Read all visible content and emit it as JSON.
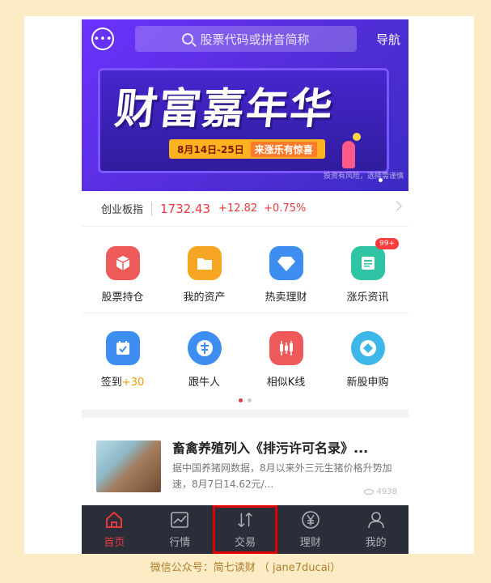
{
  "header": {
    "search_placeholder": "股票代码或拼音简称",
    "nav_label": "导航"
  },
  "banner": {
    "title": "财富嘉年华",
    "date": "8月14日-25日",
    "slogan": "来涨乐有惊喜",
    "disclaimer": "投资有风险，选择需谨慎"
  },
  "index": {
    "name": "创业板指",
    "value": "1732.43",
    "change": "+12.82",
    "pct": "+0.75%",
    "color": "#e8383d"
  },
  "grid": {
    "row1": [
      {
        "label": "股票持仓",
        "color": "#ee5a5a"
      },
      {
        "label": "我的资产",
        "color": "#f6a623"
      },
      {
        "label": "热卖理财",
        "color": "#3d8ef0"
      },
      {
        "label": "涨乐资讯",
        "color": "#2fc4a4",
        "badge": "99+"
      }
    ],
    "row2": [
      {
        "label": "签到",
        "label_highlight": "+30",
        "color": "#3d8ef0"
      },
      {
        "label": "跟牛人",
        "color": "#3d8ef0"
      },
      {
        "label": "相似K线",
        "color": "#ee5a5a"
      },
      {
        "label": "新股申购",
        "color": "#3db6e8"
      }
    ]
  },
  "news": {
    "headline": "畜禽养殖列入《排污许可名录》...",
    "summary": "据中国养猪网数据，8月以来外三元生猪价格升势加速，8月7日14.62元/...",
    "views": "4938"
  },
  "tabbar": [
    {
      "label": "首页",
      "icon": "home-icon",
      "active": true
    },
    {
      "label": "行情",
      "icon": "chart-icon"
    },
    {
      "label": "交易",
      "icon": "trade-arrows-icon",
      "highlighted": true
    },
    {
      "label": "理财",
      "icon": "yen-icon"
    },
    {
      "label": "我的",
      "icon": "person-icon"
    }
  ],
  "footer": {
    "caption": "微信公众号：简七读财 （ jane7ducai）"
  }
}
